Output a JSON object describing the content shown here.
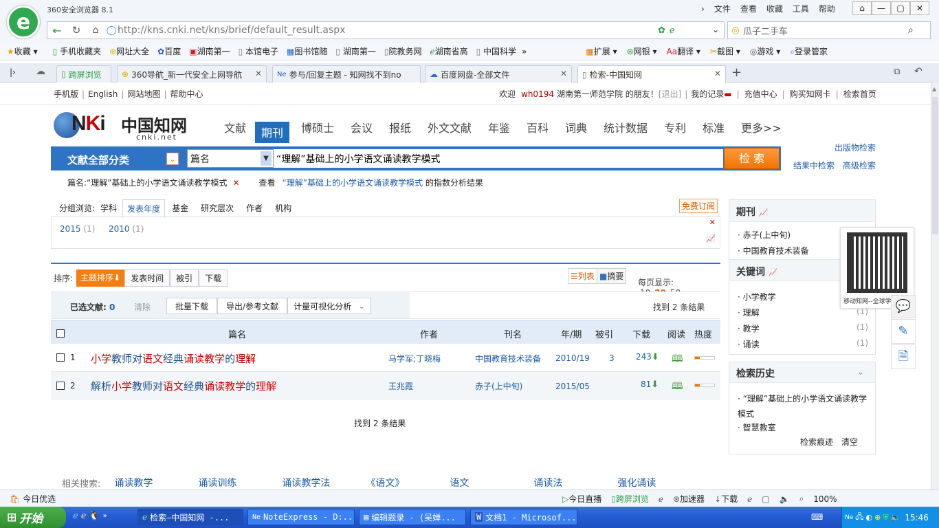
{
  "browser": {
    "title": "360安全浏览器 8.1",
    "menu": [
      "文件",
      "查看",
      "收藏",
      "工具",
      "帮助"
    ],
    "url": "http://kns.cnki.net/kns/brief/default_result.aspx",
    "search_text": "瓜子二手车",
    "bookmarks": [
      "收藏",
      "手机收藏夹",
      "网址大全",
      "百度",
      "湖南第一",
      "本馆电子",
      "图书馆随",
      "湖南第一",
      "院教务网",
      "湖南省高",
      "中国科学"
    ],
    "bookmarks_right": [
      "扩展",
      "网银",
      "翻译",
      "截图",
      "游戏",
      "登录管家"
    ],
    "tabs": [
      "跨屏浏览",
      "360导航_新一代安全上网导航",
      "参与/回复主题 - 知网找不到no",
      "百度网盘-全部文件",
      "检索-中国知网"
    ],
    "status_left": "今日优选",
    "status_right": [
      "今日直播",
      "跨屏浏览",
      "加速器",
      "下载",
      "100%"
    ]
  },
  "taskbar": {
    "start": "开始",
    "items": [
      "检索—中国知网 -...",
      "NoteExpress - D:...",
      "编辑题录 - (吴婵...",
      "文档1 - Microsof..."
    ],
    "clock": "15:46"
  },
  "top": {
    "left_links": [
      "手机版",
      "English",
      "网站地图",
      "帮助中心"
    ],
    "welcome": "欢迎",
    "user": "wh0194",
    "school": "湖南第一师范学院 的朋友！",
    "logout": "[退出]",
    "right_links": [
      "我的记录",
      "充值中心",
      "购买知网卡",
      "检索首页"
    ]
  },
  "logo": {
    "sub": "cnki.net",
    "cn": "中国知网"
  },
  "channels": [
    "文献",
    "期刊",
    "博硕士",
    "会议",
    "报纸",
    "外文文献",
    "年鉴",
    "百科",
    "词典",
    "统计数据",
    "专利",
    "标准",
    "更多>>"
  ],
  "search": {
    "category": "文献全部分类",
    "field": "篇名",
    "query": "“理解”基础上的小学语文诵读教学模式",
    "button": "检 索",
    "pub_search": "出版物检索",
    "in_result": "结果中检索",
    "advanced": "高级检索"
  },
  "query_info": {
    "label": "篇名:",
    "term": "“理解”基础上的小学语文诵读教学模式",
    "view": "查看",
    "view_term": "“理解”基础上的小学语文诵读教学模式",
    "view_suffix": "的指数分析结果"
  },
  "group": {
    "label": "分组浏览:",
    "tabs": [
      "学科",
      "发表年度",
      "基金",
      "研究层次",
      "作者",
      "机构"
    ],
    "subscribe": "免费订阅",
    "years": [
      {
        "y": "2015",
        "n": "(1)"
      },
      {
        "y": "2010",
        "n": "(1)"
      }
    ]
  },
  "sort": {
    "label": "排序:",
    "options": [
      "主题排序",
      "发表时间",
      "被引",
      "下载"
    ],
    "view_list": "列表",
    "view_abstract": "摘要",
    "per_page_label": "每页显示:",
    "per_page": [
      "10",
      "20",
      "50"
    ]
  },
  "actions": {
    "selected_label": "已选文献:",
    "selected_count": "0",
    "clear": "清除",
    "buttons": [
      "批量下载",
      "导出/参考文献",
      "计量可视化分析"
    ],
    "found": "找到 2 条结果"
  },
  "table": {
    "headers": [
      "篇名",
      "作者",
      "刊名",
      "年/期",
      "被引",
      "下载",
      "阅读",
      "热度"
    ],
    "rows": [
      {
        "no": "1",
        "title": "小学教师对语文经典诵读教学的理解",
        "author": "马学军;丁晓梅",
        "journal": "中国教育技术装备",
        "issue": "2010/19",
        "cited": "3",
        "downloads": "243"
      },
      {
        "no": "2",
        "title": "解析小学教师对语文经典诵读教学的理解",
        "author": "王兆霞",
        "journal": "赤子(上中旬)",
        "issue": "2015/05",
        "cited": "",
        "downloads": "81"
      }
    ]
  },
  "footer_found": "找到 2 条结果",
  "related": {
    "label": "相关搜索:",
    "terms": [
      "诵读教学",
      "诵读训练",
      "诵读教学法",
      "《语文》",
      "语文",
      "诵读法",
      "强化诵读"
    ]
  },
  "sidebar": {
    "journal_title": "期刊",
    "journals": [
      "赤子(上中旬)",
      "中国教育技术装备"
    ],
    "keyword_title": "关键词",
    "keywords": [
      {
        "k": "小学教学",
        "n": "(1)"
      },
      {
        "k": "理解",
        "n": "(1)"
      },
      {
        "k": "教学",
        "n": "(1)"
      },
      {
        "k": "诵读",
        "n": "(1)"
      }
    ],
    "history_title": "检索历史",
    "history": [
      "“理解”基础上的小学语文诵读教学模式",
      "智慧教室"
    ],
    "history_trace": "检索痕迹",
    "history_clear": "清空",
    "qr_caption": "移动知网--全球学"
  }
}
